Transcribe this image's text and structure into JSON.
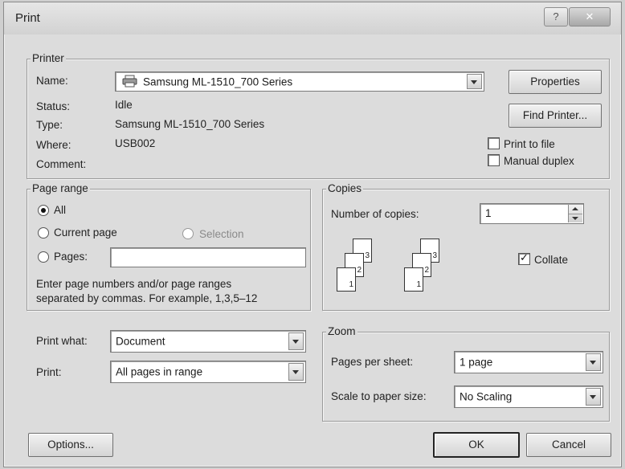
{
  "window": {
    "title": "Print",
    "help_glyph": "?",
    "close_glyph": "✕"
  },
  "printer": {
    "legend": "Printer",
    "name_label": "Name:",
    "name_value": "Samsung ML-1510_700 Series",
    "properties_button": "Properties",
    "find_printer_button": "Find Printer...",
    "status_label": "Status:",
    "status_value": "Idle",
    "type_label": "Type:",
    "type_value": "Samsung ML-1510_700 Series",
    "where_label": "Where:",
    "where_value": "USB002",
    "comment_label": "Comment:",
    "comment_value": "",
    "print_to_file_label": "Print to file",
    "print_to_file_checked": false,
    "manual_duplex_label": "Manual duplex",
    "manual_duplex_checked": false
  },
  "page_range": {
    "legend": "Page range",
    "all_label": "All",
    "current_page_label": "Current page",
    "selection_label": "Selection",
    "pages_label": "Pages:",
    "pages_value": "",
    "selected": "all",
    "hint_line1": "Enter page numbers and/or page ranges",
    "hint_line2": "separated by commas.  For example, 1,3,5–12"
  },
  "copies": {
    "legend": "Copies",
    "number_label": "Number of copies:",
    "number_value": "1",
    "collate_label": "Collate",
    "collate_checked": true,
    "page_numbers": [
      "1",
      "2",
      "3"
    ]
  },
  "print_what": {
    "label": "Print what:",
    "value": "Document"
  },
  "print": {
    "label": "Print:",
    "value": "All pages in range"
  },
  "zoom": {
    "legend": "Zoom",
    "pages_per_sheet_label": "Pages per sheet:",
    "pages_per_sheet_value": "1 page",
    "scale_label": "Scale to paper size:",
    "scale_value": "No Scaling"
  },
  "footer": {
    "options_button": "Options...",
    "ok_button": "OK",
    "cancel_button": "Cancel"
  }
}
